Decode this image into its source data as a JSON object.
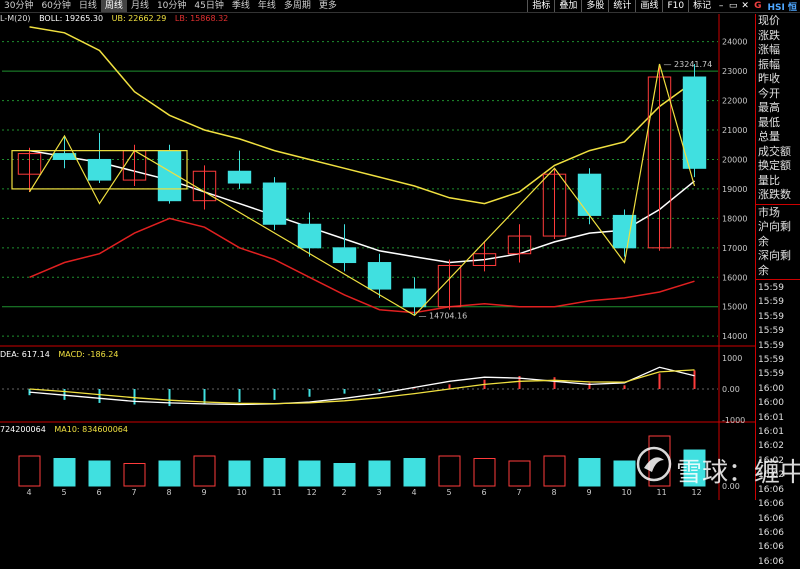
{
  "toolbar": {
    "periods": [
      "30分钟",
      "60分钟",
      "日线",
      "周线",
      "月线",
      "10分钟",
      "45日钟",
      "季线",
      "年线",
      "多周期",
      "更多"
    ],
    "active_period": "周线",
    "tools": [
      "指标",
      "叠加",
      "多股",
      "统计",
      "画线",
      "F10",
      "标记"
    ],
    "window_buttons": [
      "–",
      "▭",
      "✕"
    ],
    "ticker_prefix": "G",
    "ticker_name": "HSI 恒"
  },
  "boll_readout": {
    "prefix": "L-M(20)",
    "boll": "BOLL: 19265.30",
    "ub": "UB: 22662.29",
    "lb": "LB: 15868.32"
  },
  "macd_readout": {
    "dea": "DEA: 617.14",
    "macd": "MACD: -186.24"
  },
  "volume_readout": {
    "vol": "724200064",
    "ma10": "MA10: 834600064"
  },
  "annotations": {
    "high": "23241.74",
    "low": "14704.16"
  },
  "price_axis": [
    "24000",
    "23000",
    "22000",
    "21000",
    "20000",
    "19000",
    "18000",
    "17000",
    "16000",
    "15000",
    "14000"
  ],
  "macd_axis": [
    "1000",
    "0.00",
    "-1000"
  ],
  "vol_axis": [
    "0.00"
  ],
  "x_ticks": [
    "4",
    "5",
    "6",
    "7",
    "8",
    "9",
    "10",
    "11",
    "12",
    "2",
    "3",
    "4",
    "5",
    "6",
    "7",
    "8",
    "9",
    "10",
    "11",
    "12"
  ],
  "side_panel": {
    "quote_labels": [
      "现价",
      "涨跌",
      "涨幅",
      "振幅",
      "昨收",
      "今开",
      "最高",
      "最低",
      "总量",
      "成交额",
      "换定额",
      "量比",
      "涨跌数"
    ],
    "market_labels": [
      "市场",
      "沪向剩余",
      "深向剩余"
    ],
    "times": [
      "15:59",
      "15:59",
      "15:59",
      "15:59",
      "15:59",
      "15:59",
      "15:59",
      "16:00",
      "16:00",
      "16:01",
      "16:01",
      "16:02",
      "16:02",
      "16:02",
      "16:06",
      "16:06",
      "16:06",
      "16:06",
      "16:06",
      "16:06"
    ]
  },
  "watermark": "雪球：缠中",
  "colors": {
    "up": "#ff3b3b",
    "down": "#40e0e0",
    "ma_white": "#ffffff",
    "ma_yellow": "#f0e040",
    "lb_red": "#e02020",
    "grid_green": "#1f8f2f"
  },
  "chart_data": {
    "type": "candlestick",
    "title": "",
    "xlabel": "",
    "ylabel": "",
    "ylim": [
      13700,
      24600
    ],
    "x": [
      "4",
      "5",
      "6",
      "7",
      "8",
      "9",
      "10",
      "11",
      "12",
      "2",
      "3",
      "4",
      "5",
      "6",
      "7",
      "8",
      "9",
      "10",
      "11",
      "12"
    ],
    "candles": [
      {
        "o": 19500,
        "h": 20400,
        "l": 18900,
        "c": 20200
      },
      {
        "o": 20200,
        "h": 20800,
        "l": 19700,
        "c": 20000
      },
      {
        "o": 20000,
        "h": 20900,
        "l": 19200,
        "c": 19300
      },
      {
        "o": 19300,
        "h": 20500,
        "l": 19100,
        "c": 20300
      },
      {
        "o": 20300,
        "h": 20500,
        "l": 18500,
        "c": 18600
      },
      {
        "o": 18600,
        "h": 19800,
        "l": 18300,
        "c": 19600
      },
      {
        "o": 19600,
        "h": 20300,
        "l": 19000,
        "c": 19200
      },
      {
        "o": 19200,
        "h": 19400,
        "l": 17600,
        "c": 17800
      },
      {
        "o": 17800,
        "h": 18200,
        "l": 16700,
        "c": 17000
      },
      {
        "o": 17000,
        "h": 17800,
        "l": 16200,
        "c": 16500
      },
      {
        "o": 16500,
        "h": 16800,
        "l": 15300,
        "c": 15600
      },
      {
        "o": 15600,
        "h": 16000,
        "l": 14704,
        "c": 15000
      },
      {
        "o": 15000,
        "h": 16600,
        "l": 14900,
        "c": 16400
      },
      {
        "o": 16400,
        "h": 17200,
        "l": 16200,
        "c": 16800
      },
      {
        "o": 16800,
        "h": 17800,
        "l": 16500,
        "c": 17400
      },
      {
        "o": 17400,
        "h": 19700,
        "l": 17300,
        "c": 19500
      },
      {
        "o": 19500,
        "h": 19700,
        "l": 17800,
        "c": 18100
      },
      {
        "o": 18100,
        "h": 18300,
        "l": 16700,
        "c": 17000
      },
      {
        "o": 17000,
        "h": 23241,
        "l": 16900,
        "c": 22800
      },
      {
        "o": 22800,
        "h": 23241,
        "l": 19400,
        "c": 19700
      }
    ],
    "boll_mid": [
      20300,
      20100,
      19900,
      19600,
      19300,
      18900,
      18500,
      18100,
      17700,
      17300,
      16900,
      16700,
      16500,
      16600,
      16800,
      17200,
      17500,
      17600,
      18300,
      19265
    ],
    "boll_upper": [
      24500,
      24300,
      23700,
      22300,
      21500,
      21000,
      20700,
      20300,
      20000,
      19700,
      19400,
      19100,
      18700,
      18500,
      18900,
      19800,
      20300,
      20600,
      21800,
      22662
    ],
    "boll_lower": [
      16000,
      16500,
      16800,
      17500,
      18000,
      17700,
      17000,
      16600,
      16000,
      15400,
      14900,
      14800,
      15000,
      15100,
      15000,
      15000,
      15200,
      15300,
      15500,
      15868
    ],
    "zigzag": [
      {
        "i": 0,
        "v": 18900
      },
      {
        "i": 1,
        "v": 20800
      },
      {
        "i": 2,
        "v": 18500
      },
      {
        "i": 3,
        "v": 20300
      },
      {
        "i": 11,
        "v": 14704
      },
      {
        "i": 15,
        "v": 19700
      },
      {
        "i": 17,
        "v": 16500
      },
      {
        "i": 18,
        "v": 23241
      },
      {
        "i": 19,
        "v": 19100
      }
    ],
    "macd_hist": [
      -200,
      -350,
      -450,
      -500,
      -550,
      -500,
      -420,
      -350,
      -250,
      -150,
      -80,
      20,
      150,
      300,
      420,
      380,
      200,
      120,
      500,
      600
    ],
    "macd_dif": [
      -100,
      -200,
      -300,
      -400,
      -450,
      -480,
      -500,
      -480,
      -420,
      -300,
      -150,
      50,
      250,
      380,
      350,
      250,
      150,
      200,
      700,
      430
    ],
    "macd_dea": [
      0,
      -80,
      -180,
      -280,
      -360,
      -420,
      -460,
      -470,
      -450,
      -380,
      -280,
      -150,
      0,
      150,
      250,
      280,
      230,
      220,
      550,
      617
    ],
    "volume": [
      0.6,
      0.55,
      0.5,
      0.45,
      0.5,
      0.6,
      0.5,
      0.55,
      0.5,
      0.45,
      0.5,
      0.55,
      0.6,
      0.55,
      0.5,
      0.6,
      0.55,
      0.5,
      1.0,
      0.72
    ]
  }
}
